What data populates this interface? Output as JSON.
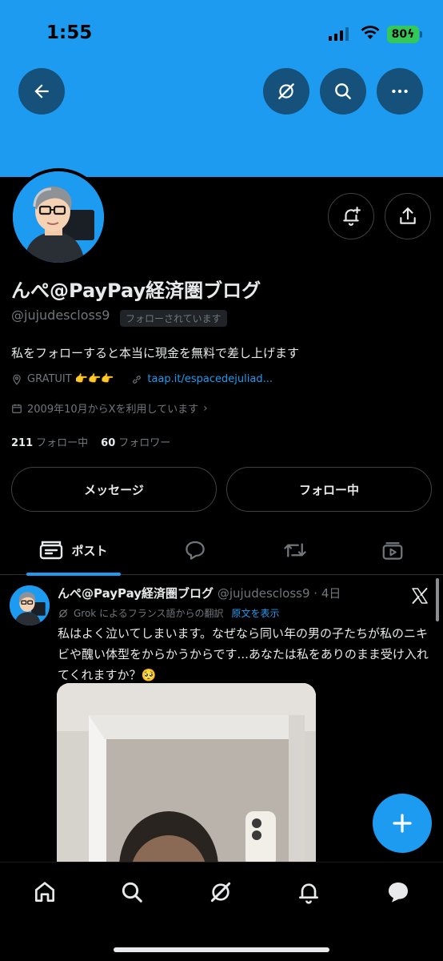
{
  "status_bar": {
    "time": "1:55",
    "battery": "80"
  },
  "profile": {
    "name": "んぺ@PayPay経済圏ブログ",
    "handle": "@jujudescloss9",
    "follows_you": "フォローされています",
    "bio": "私をフォローすると本当に現金を無料で差し上げます",
    "location": "GRATUIT 👉👉👉",
    "website": "taap.it/espacedejuliad...",
    "joined": "2009年10月からXを利用しています",
    "following_count": "211",
    "following_label": "フォロー中",
    "followers_count": "60",
    "followers_label": "フォロワー"
  },
  "actions": {
    "message": "メッセージ",
    "following": "フォロー中"
  },
  "tabs": {
    "posts": "ポスト"
  },
  "post": {
    "name": "んぺ@PayPay経済圏ブログ",
    "meta": "@jujudescloss9 · 4日",
    "translation_note": "Grok によるフランス語からの翻訳",
    "show_original": "原文を表示",
    "text": "私はよく泣いてしまいます。なぜなら同い年の男の子たちが私のニキビや醜い体型をからかうからです...あなたは私をありのまま受け入れてくれますか？🥺"
  },
  "colors": {
    "accent": "#1d9bf0",
    "background": "#000000",
    "secondary_text": "#71767b"
  },
  "icons": [
    "back-arrow-icon",
    "grok-icon",
    "search-icon",
    "more-icon",
    "bell-plus-icon",
    "share-icon",
    "location-icon",
    "link-icon",
    "calendar-icon",
    "posts-tab-icon",
    "replies-tab-icon",
    "reposts-tab-icon",
    "media-tab-icon",
    "x-logo-icon",
    "grok-translate-icon",
    "plus-icon",
    "home-icon",
    "notifications-icon",
    "messages-icon"
  ]
}
